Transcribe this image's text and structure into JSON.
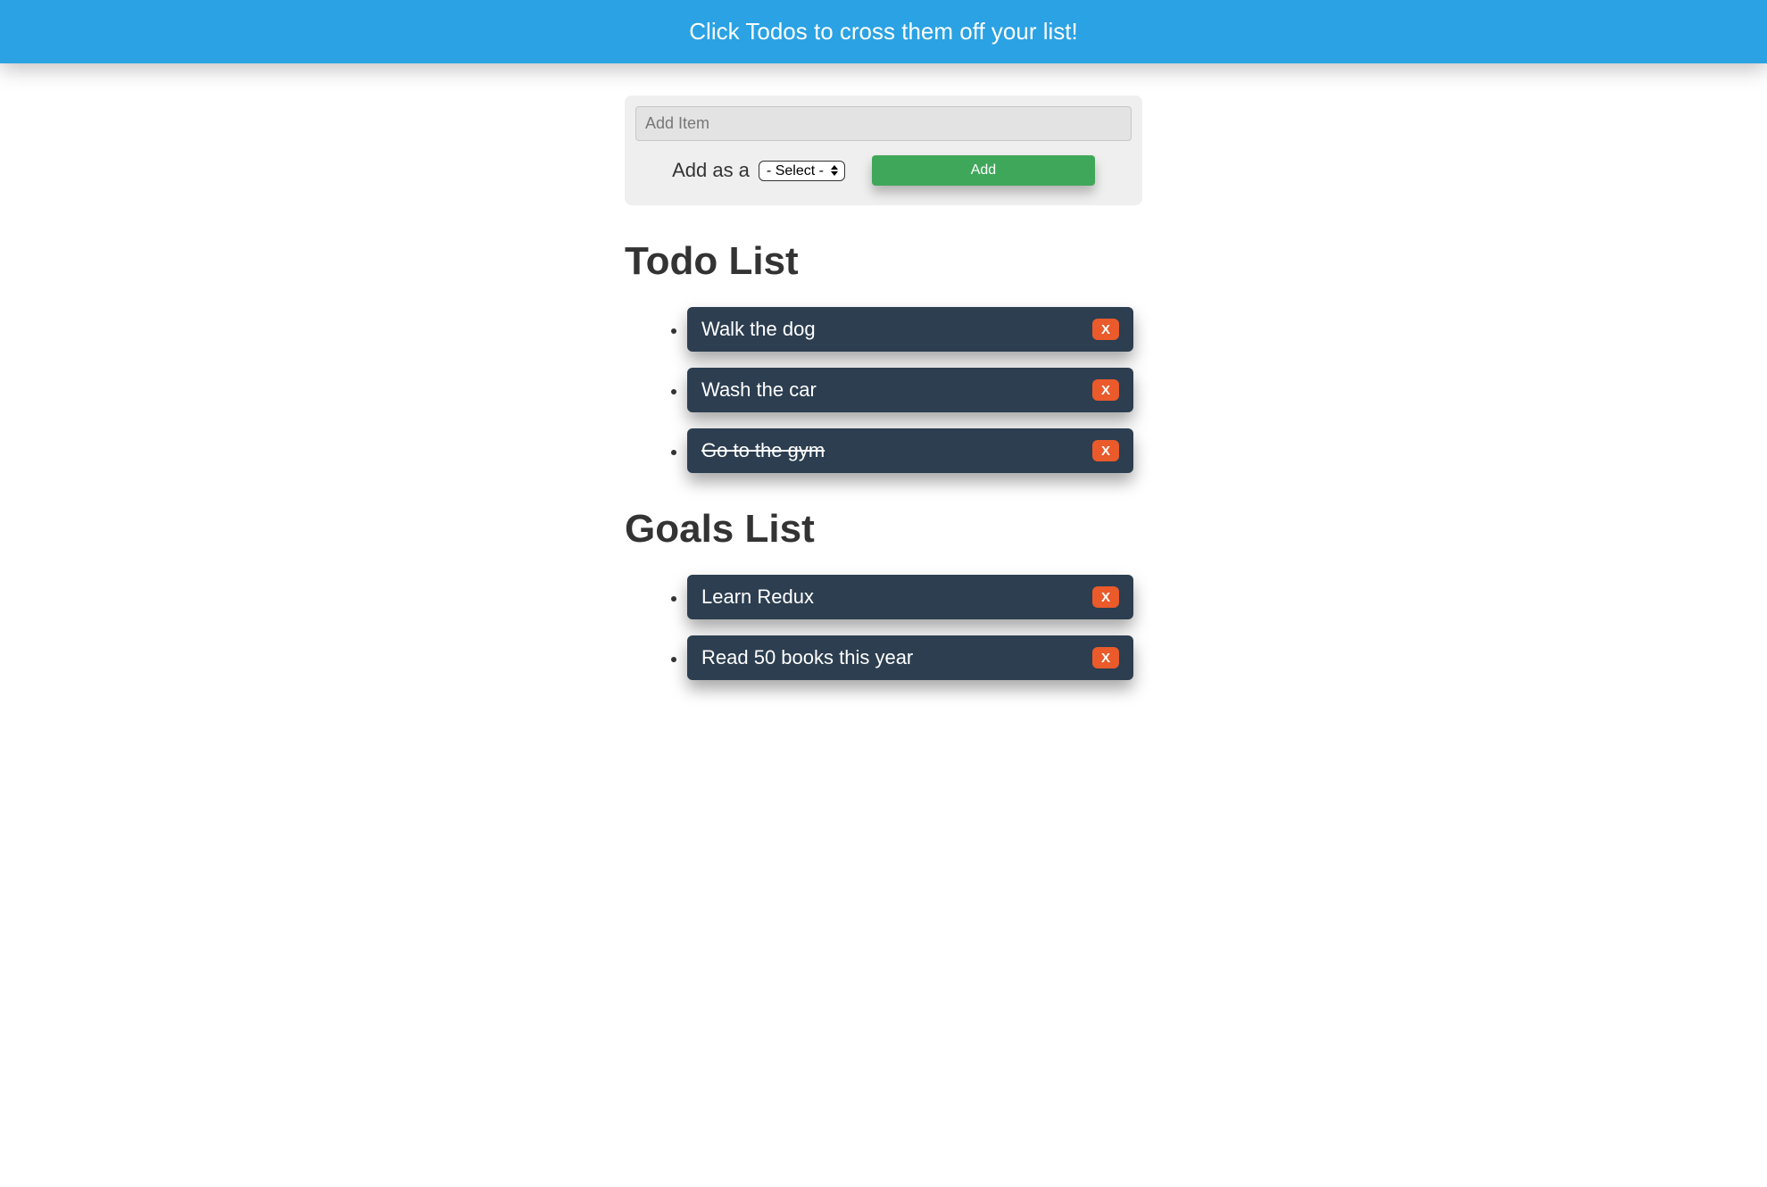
{
  "banner": {
    "text": "Click Todos to cross them off your list!"
  },
  "addPanel": {
    "input_placeholder": "Add Item",
    "label": "Add as a",
    "select_placeholder": "- Select -",
    "add_button_label": "Add"
  },
  "sections": {
    "todos": {
      "heading": "Todo List",
      "items": [
        {
          "text": "Walk the dog",
          "done": false
        },
        {
          "text": "Wash the car",
          "done": false
        },
        {
          "text": "Go to the gym",
          "done": true
        }
      ]
    },
    "goals": {
      "heading": "Goals List",
      "items": [
        {
          "text": "Learn Redux",
          "done": false
        },
        {
          "text": "Read 50 books this year",
          "done": false
        }
      ]
    }
  },
  "delete_label": "X",
  "colors": {
    "banner_bg": "#2AA2E3",
    "card_bg": "#2C3E50",
    "add_btn_bg": "#3fa75a",
    "delete_btn_bg": "#EA5A2B"
  }
}
